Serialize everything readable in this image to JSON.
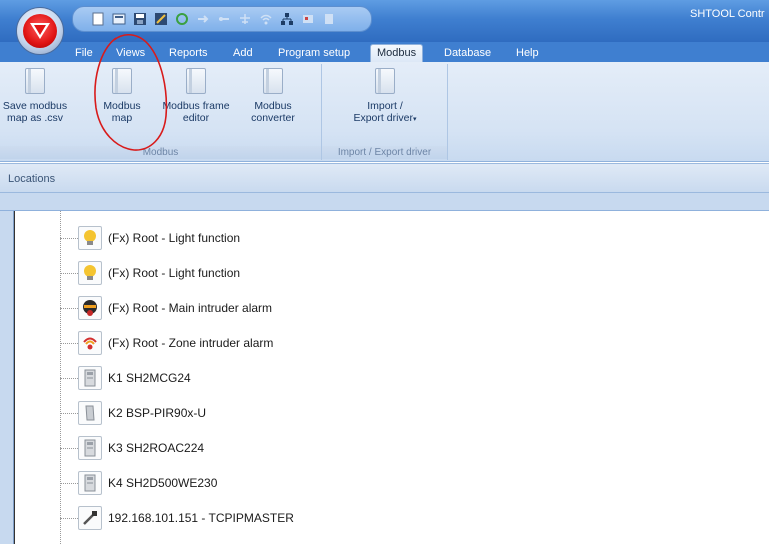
{
  "window": {
    "title": "SHTOOL Contr"
  },
  "menu_tabs": [
    {
      "label": "File"
    },
    {
      "label": "Views"
    },
    {
      "label": "Reports"
    },
    {
      "label": "Add"
    },
    {
      "label": "Program setup"
    },
    {
      "label": "Modbus",
      "active": true
    },
    {
      "label": "Database"
    },
    {
      "label": "Help"
    }
  ],
  "ribbon": {
    "groups": [
      {
        "label": "Modbus",
        "buttons": [
          {
            "line1": "Save modbus",
            "line2": "map as .csv"
          },
          {
            "line1": "Modbus",
            "line2": "map"
          },
          {
            "line1": "Modbus frame",
            "line2": "editor"
          },
          {
            "line1": "Modbus",
            "line2": "converter"
          }
        ]
      },
      {
        "label": "Import / Export driver",
        "buttons": [
          {
            "line1": "Import /",
            "line2": "Export driver",
            "has_dropdown": true
          }
        ]
      }
    ]
  },
  "panel": {
    "title": "Locations"
  },
  "tree": {
    "items": [
      {
        "label": "(Fx) Root - Light function",
        "icon": "light-bulb-icon"
      },
      {
        "label": "(Fx) Root - Light function",
        "icon": "light-bulb-icon"
      },
      {
        "label": "(Fx) Root - Main intruder alarm",
        "icon": "intruder-alarm-icon"
      },
      {
        "label": "(Fx) Root - Zone intruder alarm",
        "icon": "zone-alarm-icon"
      },
      {
        "label": "K1 SH2MCG24",
        "icon": "module-icon"
      },
      {
        "label": "K2 BSP-PIR90x-U",
        "icon": "pir-sensor-icon"
      },
      {
        "label": "K3 SH2ROAC224",
        "icon": "module-icon"
      },
      {
        "label": "K4 SH2D500WE230",
        "icon": "module-icon"
      },
      {
        "label": "192.168.101.151 - TCPIPMASTER",
        "icon": "tcpip-master-icon"
      }
    ]
  },
  "colors": {
    "title_bar": "#3f7fd0",
    "ribbon_bg": "#d5e3f4",
    "annotation_red": "#d81b1b",
    "logo_red": "#e01414"
  }
}
